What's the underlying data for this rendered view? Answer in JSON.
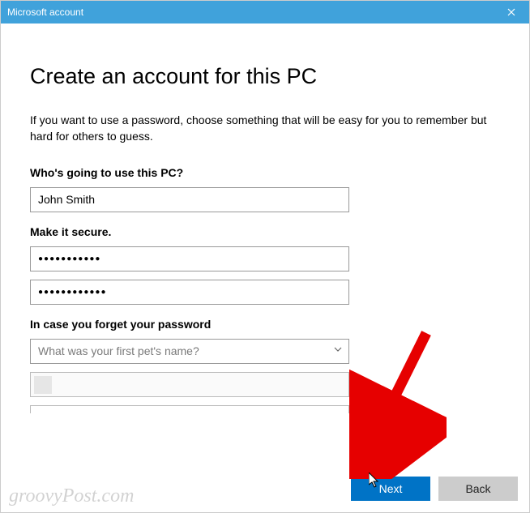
{
  "titlebar": {
    "title": "Microsoft account"
  },
  "heading": "Create an account for this PC",
  "description": "If you want to use a password, choose something that will be easy for you to remember but hard for others to guess.",
  "section_user": {
    "label": "Who's going to use this PC?",
    "username_value": "John Smith"
  },
  "section_password": {
    "label": "Make it secure.",
    "password_value": "●●●●●●●●●●●",
    "confirm_value": "●●●●●●●●●●●●"
  },
  "section_hint": {
    "label": "In case you forget your password",
    "question_selected": "What was your first pet's name?"
  },
  "buttons": {
    "next": "Next",
    "back": "Back"
  },
  "watermark": "groovyPost.com"
}
